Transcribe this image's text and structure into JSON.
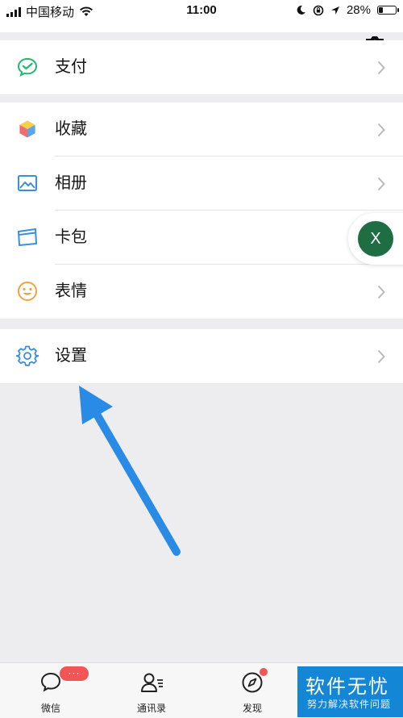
{
  "status_bar": {
    "carrier": "中国移动",
    "time": "11:00",
    "battery": "28%",
    "battery_level": 0.28
  },
  "menu": {
    "group1": [
      {
        "label": "支付",
        "icon": "pay-icon"
      }
    ],
    "group2": [
      {
        "label": "收藏",
        "icon": "favorites-icon"
      },
      {
        "label": "相册",
        "icon": "album-icon"
      },
      {
        "label": "卡包",
        "icon": "card-wallet-icon"
      },
      {
        "label": "表情",
        "icon": "sticker-smile-icon"
      }
    ],
    "group3": [
      {
        "label": "设置",
        "icon": "settings-gear-icon"
      }
    ]
  },
  "float_button": {
    "label": "X",
    "color": "#1f6e43"
  },
  "tabbar": {
    "tabs": [
      {
        "label": "微信",
        "icon": "chat-bubble-icon"
      },
      {
        "label": "通讯录",
        "icon": "contacts-icon"
      },
      {
        "label": "发现",
        "icon": "compass-icon"
      }
    ],
    "chat_badge": "···"
  },
  "watermark": {
    "title": "软件无忧",
    "subtitle": "努力解决软件问题"
  },
  "colors": {
    "accent_green": "#07c160",
    "arrow_blue": "#2a8be6",
    "badge_red": "#f25555"
  }
}
